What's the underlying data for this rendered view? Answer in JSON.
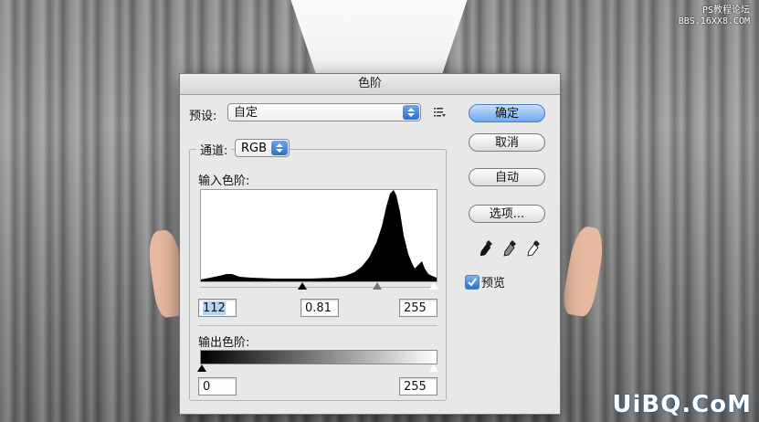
{
  "watermark": {
    "top_line1": "PS教程论坛",
    "top_line2": "BBS.16XX8.COM",
    "bottom": "UiBQ.CoM"
  },
  "dialog": {
    "title": "色阶",
    "preset": {
      "label": "预设:",
      "value": "自定"
    },
    "channel": {
      "label": "通道:",
      "value": "RGB"
    },
    "input_levels": {
      "label": "输入色阶:",
      "black": "112",
      "gamma": "0.81",
      "white": "255"
    },
    "output_levels": {
      "label": "输出色阶:",
      "black": "0",
      "white": "255"
    },
    "buttons": {
      "ok": "确定",
      "cancel": "取消",
      "auto": "自动",
      "options": "选项..."
    },
    "preview": {
      "label": "预览",
      "checked": true
    },
    "colors": {
      "accent": "#2e6ed1",
      "dialog_bg": "#e8e8e8"
    }
  }
}
